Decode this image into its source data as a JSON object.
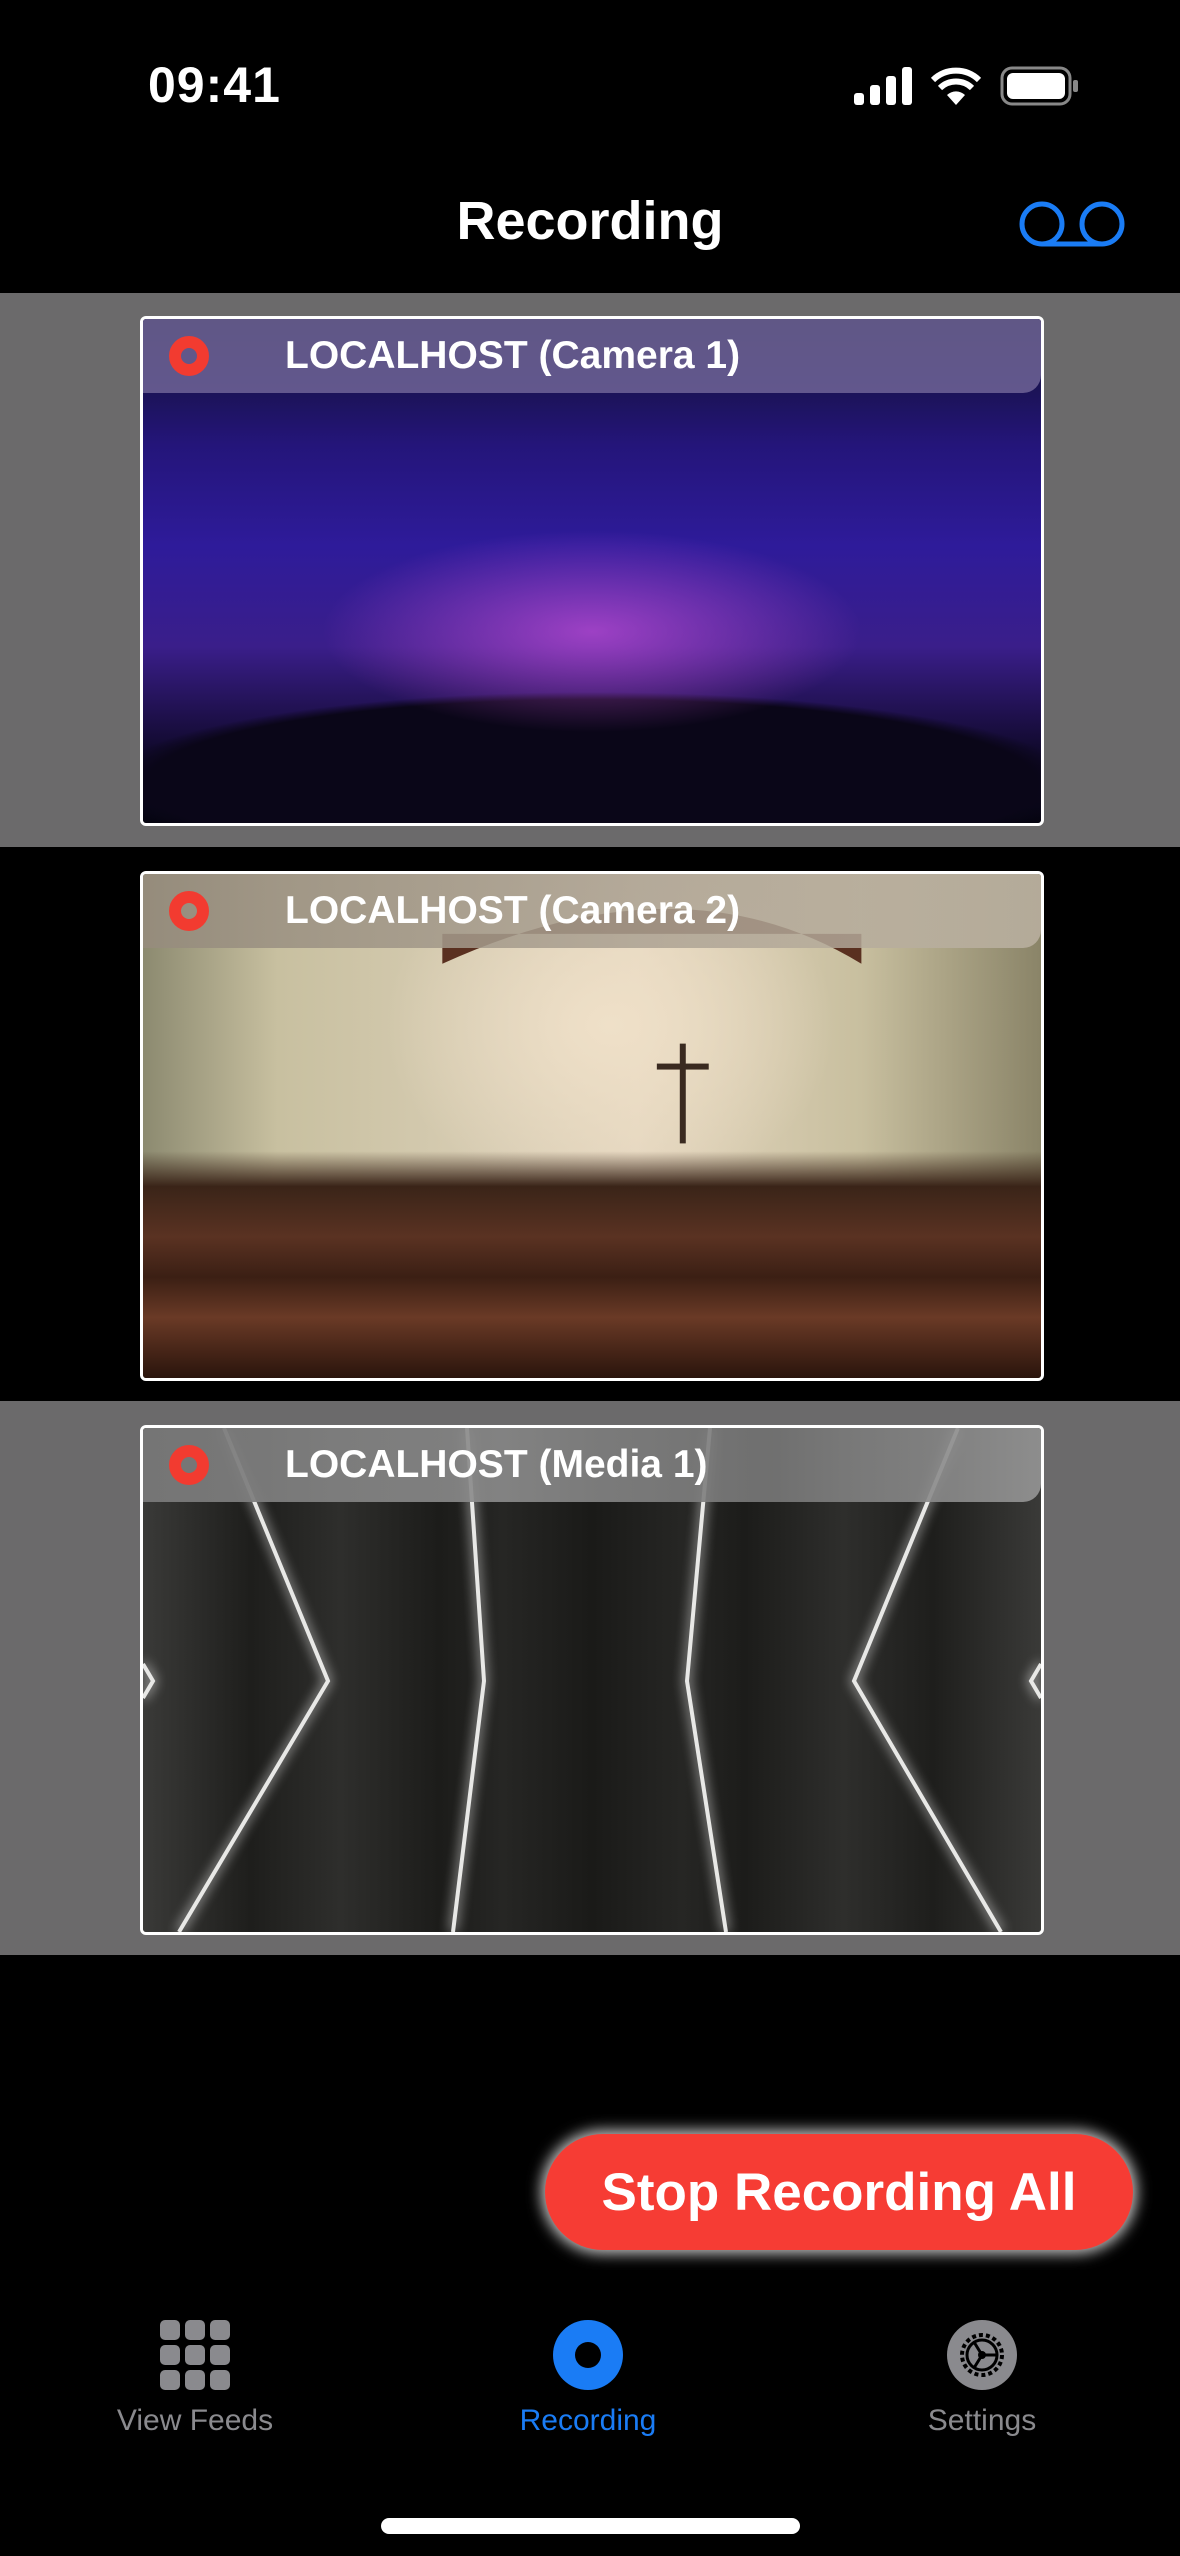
{
  "status_bar": {
    "time": "09:41"
  },
  "nav": {
    "title": "Recording",
    "right_icon": "voicemail-icon"
  },
  "feeds": [
    {
      "label": "LOCALHOST (Camera 1)",
      "recording": true
    },
    {
      "label": "LOCALHOST (Camera 2)",
      "recording": true
    },
    {
      "label": "LOCALHOST (Media 1)",
      "recording": true
    }
  ],
  "actions": {
    "stop_all": "Stop Recording All"
  },
  "tabs": [
    {
      "label": "View Feeds",
      "icon": "grid-icon",
      "active": false
    },
    {
      "label": "Recording",
      "icon": "record-icon",
      "active": true
    },
    {
      "label": "Settings",
      "icon": "gear-icon",
      "active": false
    }
  ],
  "colors": {
    "accent": "#1a7cf5",
    "record": "#f23b30",
    "stop_button": "#f63c34",
    "inactive": "#8a8a8e"
  }
}
